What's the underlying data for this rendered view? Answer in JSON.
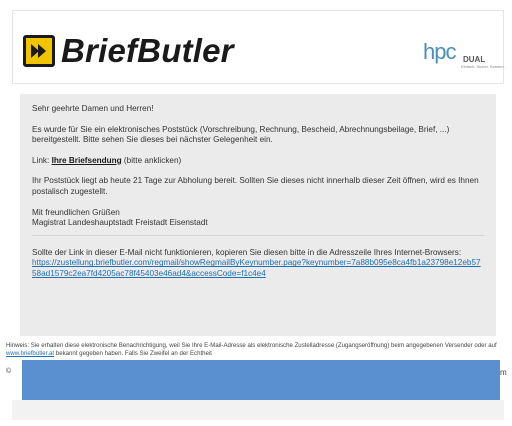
{
  "header": {
    "logo_text": "BriefButler",
    "partner_logo": {
      "letters": "hpc",
      "suffix": "DUAL",
      "tagline": "Einfach. Sicher. Senden."
    },
    "colors": {
      "logo_yellow": "#f2c400",
      "partner_blue": "#4a8fb8"
    }
  },
  "message": {
    "greeting": "Sehr geehrte Damen und Herren!",
    "intro": "Es wurde für Sie ein elektronisches Poststück (Vorschreibung, Rechnung, Bescheid, Abrechnungsbeilage, Brief, ...) bereitgestellt. Bitte sehen Sie dieses bei nächster Gelegenheit ein.",
    "link_prefix": "Link: ",
    "link_label": "Ihre Briefsendung",
    "link_suffix": " (bitte anklicken)",
    "availability": "Ihr Poststück liegt ab heute 21 Tage zur Abholung bereit. Sollten Sie dieses nicht innerhalb dieser Zeit öffnen, wird es Ihnen postalisch zugestellt.",
    "closing": "Mit freundlichen Grüßen",
    "sender": "Magistrat Landeshauptstadt Freistadt Eisenstadt",
    "fallback_text": "Sollte der Link in dieser E-Mail nicht funktionieren, kopieren Sie diesen bitte in die Adresszeile Ihres Internet-Browsers:",
    "fallback_url": "https://zustellung.briefbutler.com/regmail/showRegmailByKeynumber.page?keynumber=7a88b095e8ca4fb1a23798e12eb5758ad1579c2ea7fd4205ac78f45403e46ad4&accessCode=f1c4e4"
  },
  "hint": {
    "text_before": "Hinweis: Sie erhalten diese elektronische Benachrichtigung, weil Sie Ihre E-Mail-Adresse als elektronische Zustelladresse (Zugangseröffnung) beim angegebenen Versender oder auf ",
    "link": "www.briefbutler.at",
    "text_after": " bekannt gegeben haben. Falls Sie Zweifel an der Echtheit"
  },
  "trailing": {
    "left": "©",
    "right": "m"
  },
  "colors": {
    "message_bg": "#ebebeb",
    "link_blue": "#1f6fb2",
    "redaction_blue": "#5a90d0"
  }
}
